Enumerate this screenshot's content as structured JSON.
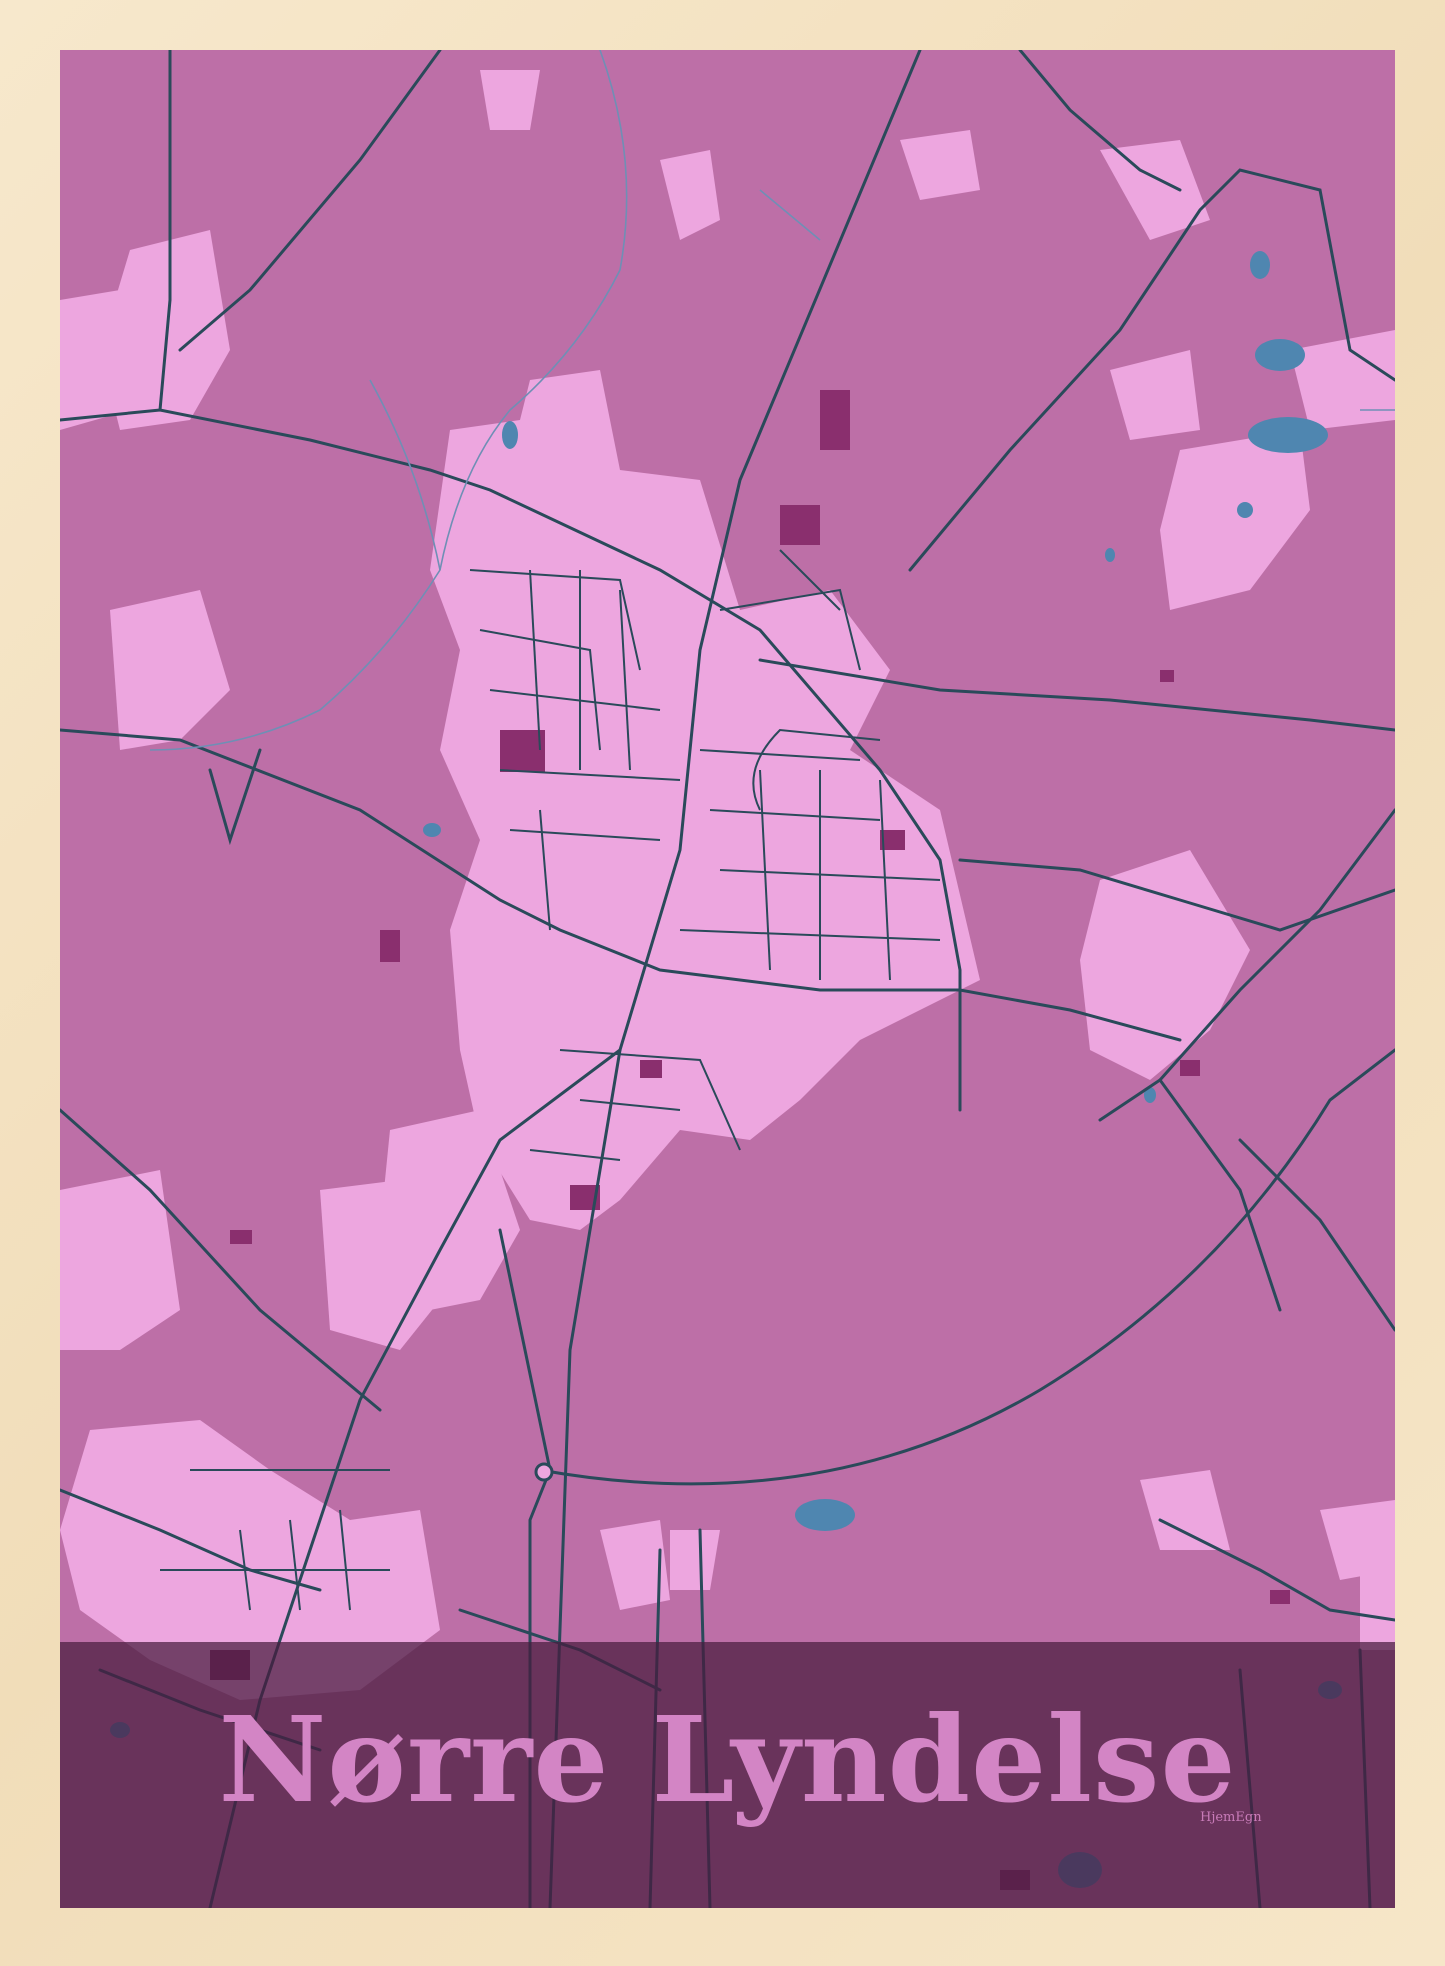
{
  "poster": {
    "title": "Nørre Lyndelse",
    "brand": "HjemEgn"
  },
  "colors": {
    "frame": "#f3e2c4",
    "land": "#bd6fa7",
    "built_area": "#eda6df",
    "buildings": "#8a2f6e",
    "roads": "#2a4a5a",
    "water": "#4f86b0",
    "band": "#481c3e",
    "title": "#d385c5"
  }
}
